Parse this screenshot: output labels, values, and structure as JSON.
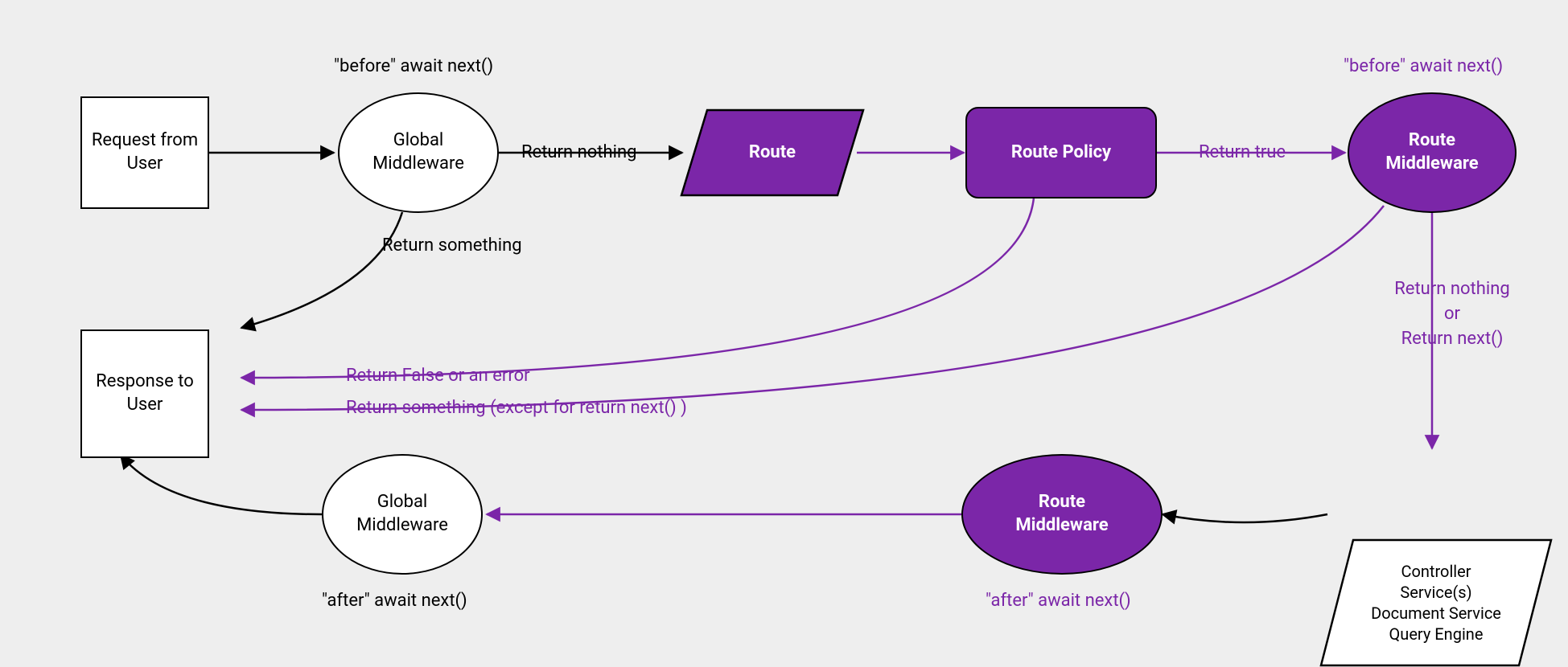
{
  "colors": {
    "purple": "#7b26a8",
    "stroke": "#000000",
    "bg": "#eeeeee"
  },
  "nodes": {
    "request": "Request from\nUser",
    "response": "Response to\nUser",
    "globalMwTop": "Global\nMiddleware",
    "globalMwBottom": "Global\nMiddleware",
    "route": "Route",
    "routePolicy": "Route Policy",
    "routeMwTop": "Route\nMiddleware",
    "routeMwBottom": "Route\nMiddleware",
    "controller": "Controller\nService(s)\nDocument Service\nQuery Engine"
  },
  "labels": {
    "beforeAwaitTop": "\"before\" await next()",
    "beforeAwaitTopRight": "\"before\" await next()",
    "afterAwaitLeft": "\"after\" await next()",
    "afterAwaitRight": "\"after\" await next()",
    "returnNothing": "Return nothing",
    "returnSomething": "Return something",
    "returnTrue": "Return true",
    "returnFalse": "Return False or an error",
    "returnSomethingExcept": "Return something (except for return next() )",
    "returnNothingOrNext": "Return nothing\nor\nReturn next()"
  }
}
